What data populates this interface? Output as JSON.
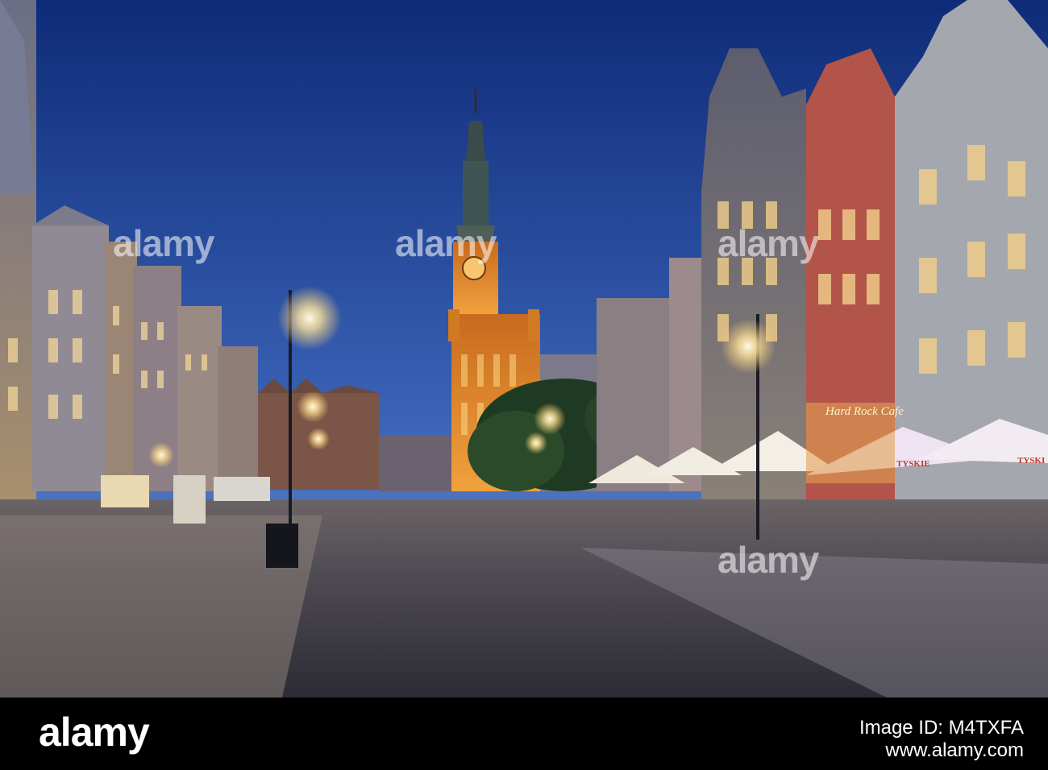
{
  "image": {
    "subject": "Old town long market street at dusk with illuminated clock tower",
    "colors": {
      "sky_top": "#0e2b78",
      "sky_bottom": "#5b7fc4",
      "tower_glow": "#e08a2a",
      "lamp_glow": "#ffe9a6",
      "umbrella": "#f1eee6",
      "footer": "#000000"
    }
  },
  "watermarks": {
    "text": "alamy",
    "instances": [
      "alamy",
      "alamy",
      "alamy",
      "alamy"
    ]
  },
  "signs": {
    "cafe": "Hard Rock Cafe",
    "umbrella_brand": "TYSKIE",
    "umbrella_brand_partial": "TYSKI"
  },
  "footer": {
    "logo": "alamy",
    "image_id_label": "Image ID: M4TXFA",
    "url": "www.alamy.com"
  }
}
